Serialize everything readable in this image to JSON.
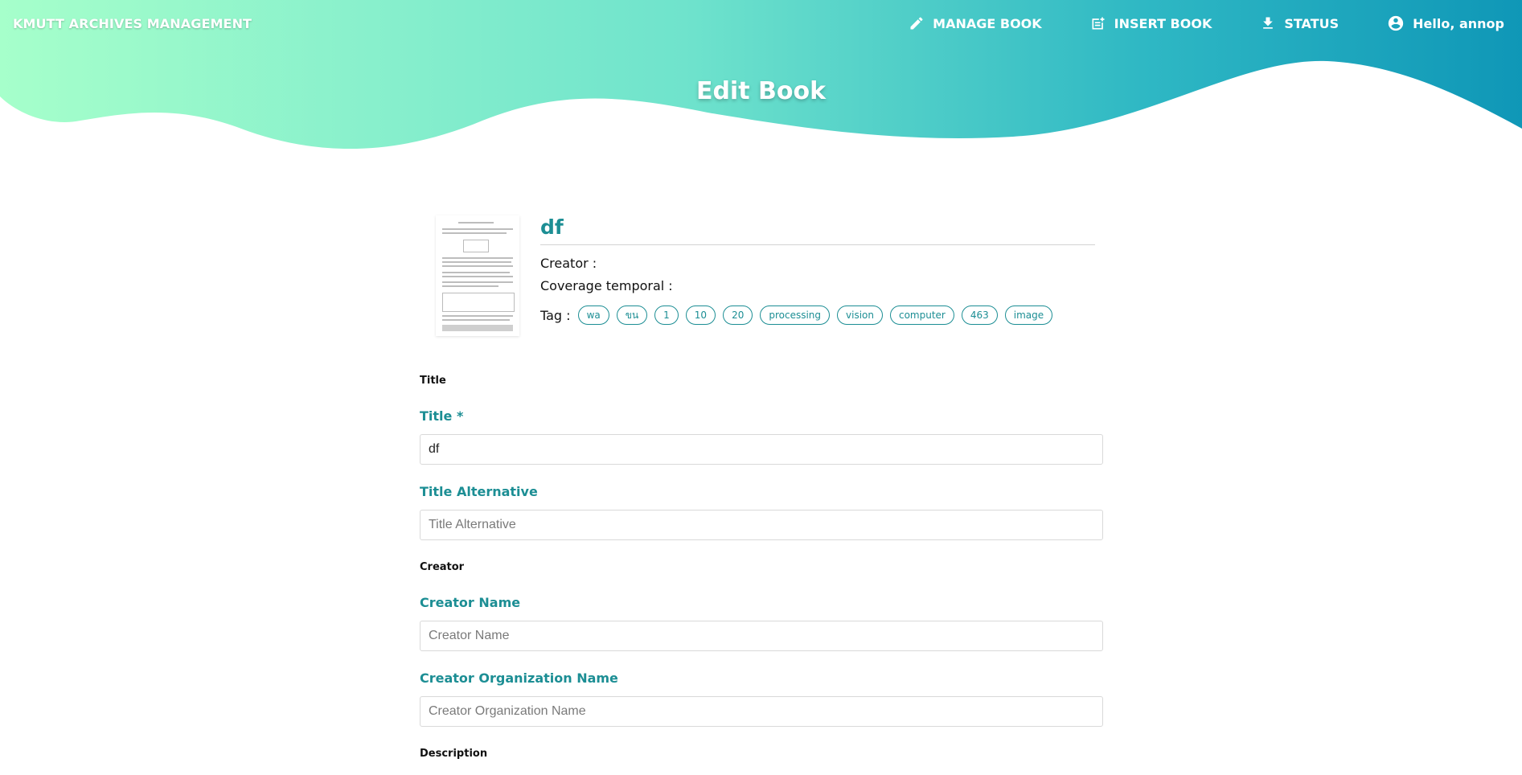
{
  "header": {
    "brand": "KMUTT ARCHIVES MANAGEMENT",
    "nav": [
      {
        "label": "MANAGE BOOK",
        "icon": "pencil-icon"
      },
      {
        "label": "INSERT BOOK",
        "icon": "note-add-icon"
      },
      {
        "label": "STATUS",
        "icon": "download-icon"
      },
      {
        "label": "Hello, annop",
        "icon": "account-circle-icon"
      }
    ],
    "page_title": "Edit Book",
    "gradient": [
      "#a6ffcb",
      "#12d8c4",
      "#1fa2c2",
      "#0093b5"
    ]
  },
  "book": {
    "title": "df",
    "creator_label": "Creator :",
    "creator_value": "",
    "coverage_label": "Coverage temporal :",
    "coverage_value": "",
    "tag_label": "Tag :",
    "tags": [
      "wa",
      "ขน",
      "1",
      "10",
      "20",
      "processing",
      "vision",
      "computer",
      "463",
      "image"
    ]
  },
  "form": {
    "section_title": "Title",
    "title_label": "Title *",
    "title_value": "df",
    "title_alt_label": "Title Alternative",
    "title_alt_placeholder": "Title Alternative",
    "section_creator": "Creator",
    "creator_name_label": "Creator Name",
    "creator_name_placeholder": "Creator Name",
    "creator_org_label": "Creator Organization Name",
    "creator_org_placeholder": "Creator Organization Name",
    "section_description": "Description"
  },
  "colors": {
    "accent": "#1c8e94"
  }
}
